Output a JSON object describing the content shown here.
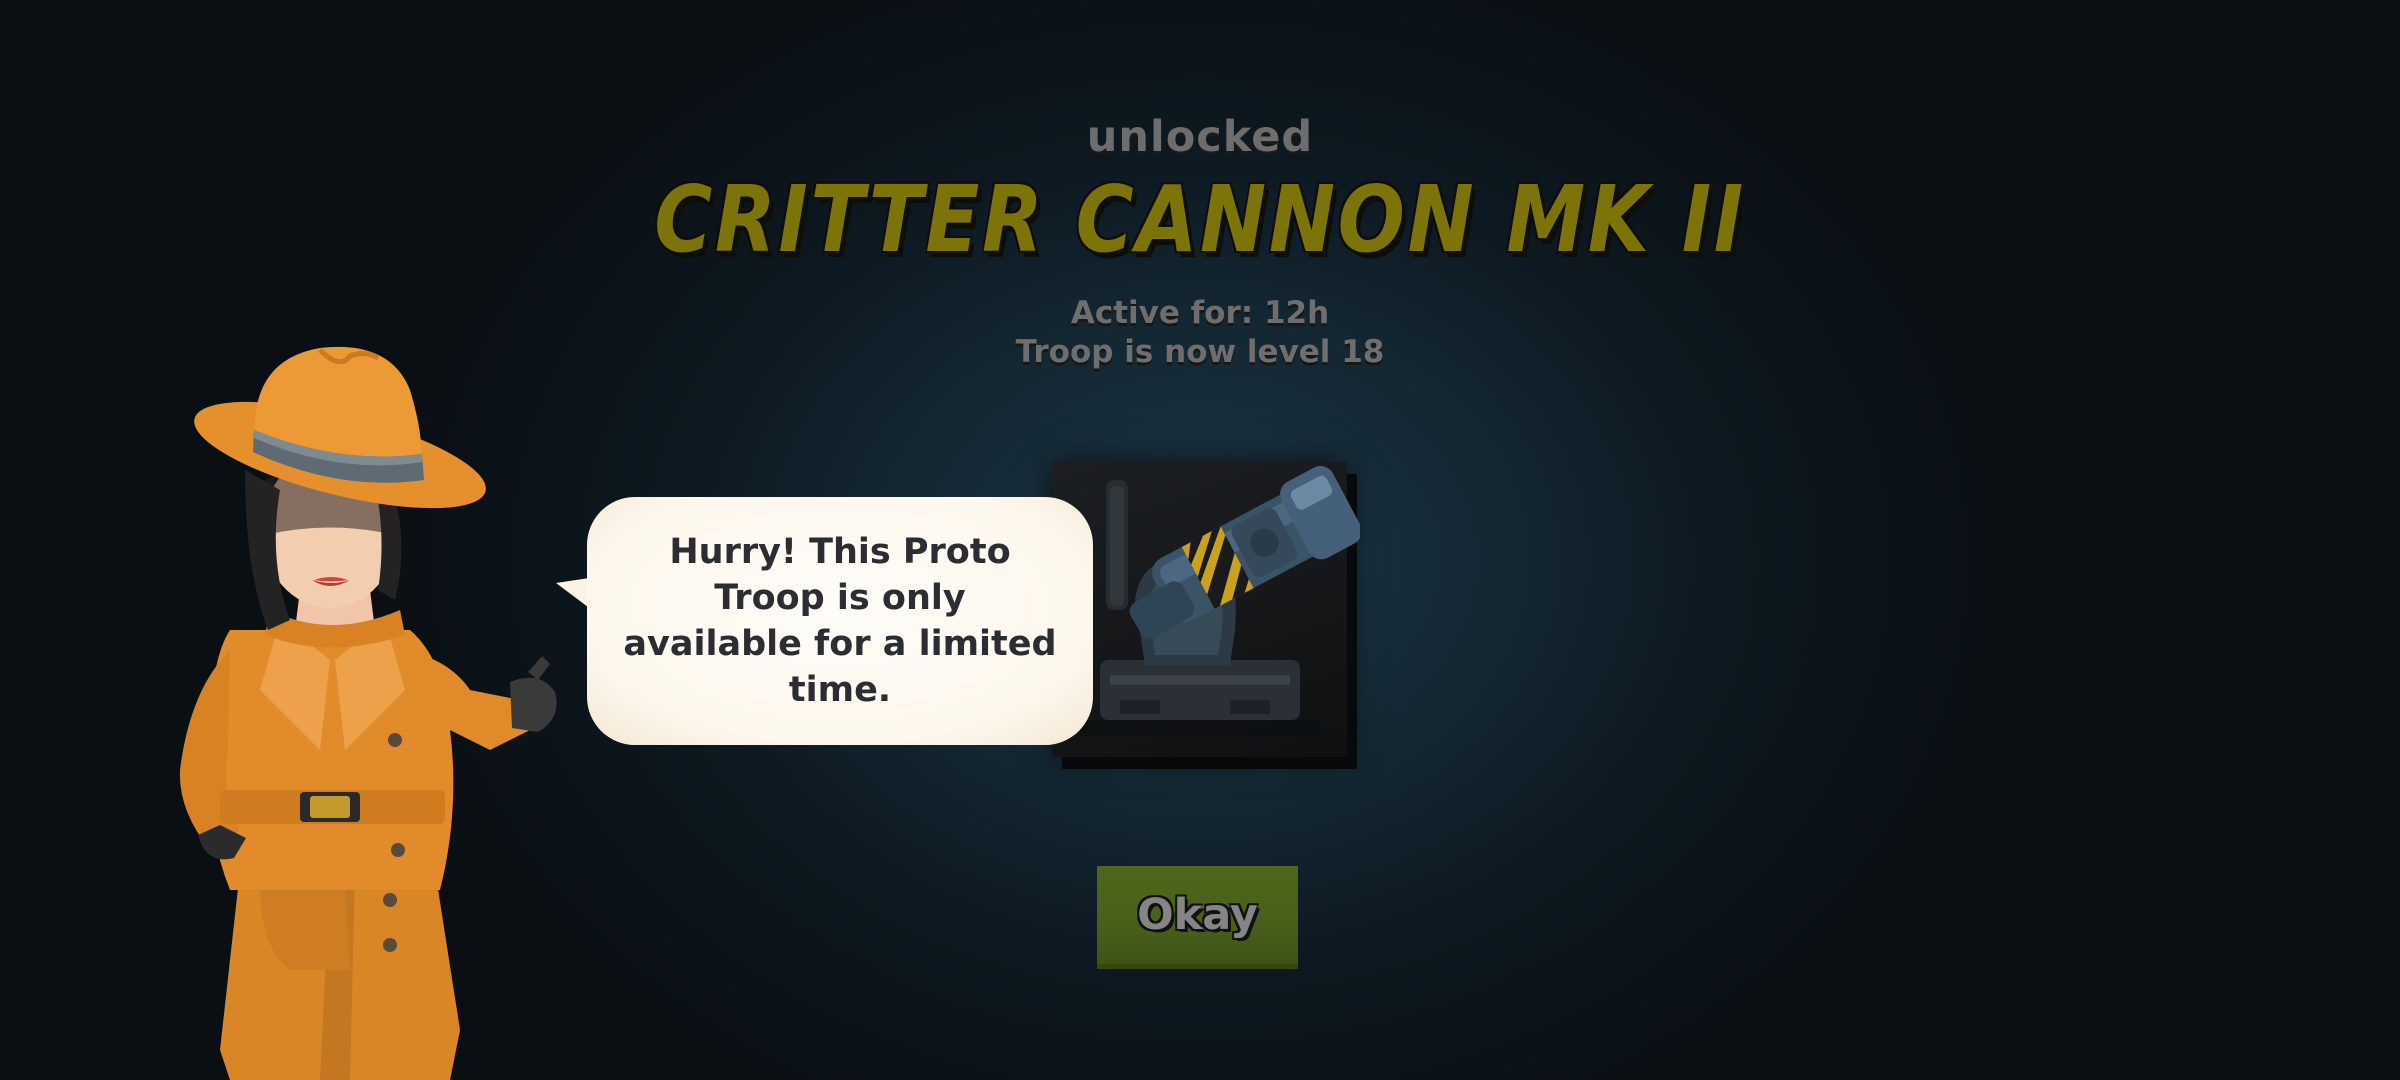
{
  "header": {
    "status": "unlocked",
    "troop_name": "CRITTER CANNON MK II",
    "active_for": "Active for: 12h",
    "level_text": "Troop is now level 18"
  },
  "dialog": {
    "message": "Hurry! This Proto Troop is only available for a limited time."
  },
  "actions": {
    "okay_label": "Okay"
  },
  "icons": {
    "troop": "critter-cannon-icon",
    "character": "detective-character"
  },
  "colors": {
    "title": "#7c7309",
    "button": "#4f661b",
    "bubble": "#fdf7ec",
    "coat": "#e08a2a"
  }
}
